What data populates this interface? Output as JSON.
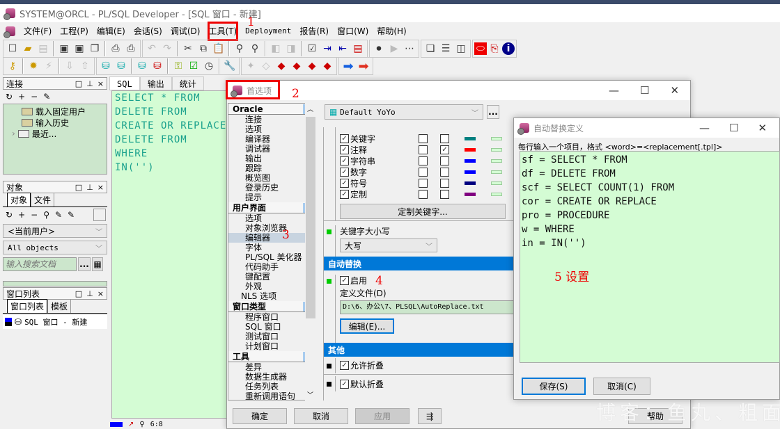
{
  "window": {
    "title": "SYSTEM@ORCL - PL/SQL Developer - [SQL 窗口 - 新建]"
  },
  "menu": [
    "文件(F)",
    "工程(P)",
    "编辑(E)",
    "会话(S)",
    "调试(D)",
    "工具(T)",
    "Deployment",
    "报告(R)",
    "窗口(W)",
    "帮助(H)"
  ],
  "annotations": {
    "a1": "1",
    "a2": "2",
    "a3": "3",
    "a4": "4",
    "a5": "5  设置"
  },
  "toolbar1": [
    "new-icon",
    "open-icon",
    "print-preview-icon",
    "save-icon",
    "save-as-icon",
    "save-all-icon",
    "print-icon",
    "print-setup-icon",
    "undo-icon",
    "redo-icon",
    "cut-icon",
    "copy-icon",
    "paste-icon",
    "find-icon",
    "find-next-icon",
    "back-icon",
    "forward-icon",
    "check-icon",
    "indent-icon",
    "unindent-icon",
    "uppercase-icon",
    "record-macro-icon",
    "play-macro-icon",
    "macro-library-icon",
    "cascade-icon",
    "tile-horizontal-icon",
    "tile-vertical-icon",
    "oracle-icon",
    "pdf-icon",
    "info-icon"
  ],
  "toolbar2": [
    "logon-icon",
    "execute-icon",
    "break-icon",
    "fetch-last-icon",
    "load-icon",
    "save-query-icon",
    "sql-window-icon",
    "new-sql-icon",
    "commit-icon",
    "rollback-icon",
    "explain-plan-icon",
    "test-icon",
    "schedule-icon",
    "wrench-icon",
    "bookmark-icon",
    "clear-icon",
    "book-red-icon",
    "book-yellow-icon",
    "book-next-icon",
    "book-prev-icon",
    "next-arrow-icon",
    "prev-arrow-icon"
  ],
  "connection_panel": {
    "title": "连接",
    "items": [
      "载入固定用户",
      "输入历史",
      "最近..."
    ]
  },
  "object_panel": {
    "title": "对象",
    "tabs": [
      "对象",
      "文件"
    ],
    "user_combo": "<当前用户>",
    "filter_combo": "All objects",
    "search_placeholder": "输入搜索文档",
    "more_label": "..."
  },
  "window_list_panel": {
    "title": "窗口列表",
    "tabs": [
      "窗口列表",
      "模板"
    ],
    "items": [
      "SQL 窗口 - 新建"
    ]
  },
  "editor": {
    "tabs": [
      "SQL",
      "输出",
      "统计"
    ],
    "lines": [
      "SELECT * FROM",
      "DELETE FROM",
      "CREATE OR REPLACE",
      "DELETE FROM",
      "WHERE",
      "IN('')"
    ],
    "status_position": "6:8"
  },
  "prefs_dialog": {
    "title": "首选项",
    "nav": [
      {
        "section": "Oracle",
        "items": [
          "连接",
          "选项",
          "编译器",
          "调试器",
          "输出",
          "跟踪",
          "概览图",
          "登录历史",
          "提示"
        ]
      },
      {
        "section": "用户界面",
        "items": [
          "选项",
          "对象浏览器",
          "编辑器",
          "字体",
          "PL/SQL 美化器",
          "代码助手",
          "键配置",
          "外观",
          "NLS 选项"
        ]
      },
      {
        "section": "窗口类型",
        "items": [
          "程序窗口",
          "SQL 窗口",
          "测试窗口",
          "计划窗口"
        ]
      },
      {
        "section": "工具",
        "items": [
          "差异",
          "数据生成器",
          "任务列表",
          "重新调用语句"
        ]
      }
    ],
    "selected_nav": "编辑器",
    "profile": "Default YoYo",
    "profile_more": "...",
    "syntax_rows": [
      {
        "label": "关键字",
        "enabled": true,
        "bold": false,
        "italic": false,
        "color": "#008080"
      },
      {
        "label": "注释",
        "enabled": true,
        "bold": false,
        "italic": true,
        "color": "#ff0000"
      },
      {
        "label": "字符串",
        "enabled": true,
        "bold": false,
        "italic": false,
        "color": "#0000ff"
      },
      {
        "label": "数字",
        "enabled": true,
        "bold": false,
        "italic": false,
        "color": "#0000ff"
      },
      {
        "label": "符号",
        "enabled": true,
        "bold": false,
        "italic": false,
        "color": "#000080"
      },
      {
        "label": "定制",
        "enabled": true,
        "bold": false,
        "italic": false,
        "color": "#800080"
      }
    ],
    "bg_swatch": "#d4fcd4",
    "custom_keywords_btn": "定制关键字...",
    "keyword_case_label": "关键字大小写",
    "keyword_case_value": "大写",
    "autoreplace_header": "自动替换",
    "enable_label": "启用",
    "deffile_label": "定义文件(D)",
    "deffile_value": "D:\\6、办公\\7、PLSQL\\AutoReplace.txt",
    "edit_btn": "编辑(E)...",
    "other_header": "其他",
    "allow_fold": "允许折叠",
    "default_fold": "默认折叠",
    "ok": "确定",
    "cancel": "取消",
    "apply": "应用",
    "help": "帮助"
  },
  "autoreplace_dialog": {
    "title": "自动替换定义",
    "hint": "每行输入一个项目，格式 <word>=<replacement[.tpl]>",
    "lines": [
      "sf = SELECT * FROM",
      "df = DELETE FROM",
      "scf = SELECT COUNT(1) FROM",
      "cor = CREATE OR REPLACE",
      "pro = PROCEDURE",
      "w = WHERE",
      "in = IN('')"
    ],
    "save": "保存(S)",
    "cancel": "取消(C)"
  },
  "watermark": "博客：鱼丸、粗面"
}
